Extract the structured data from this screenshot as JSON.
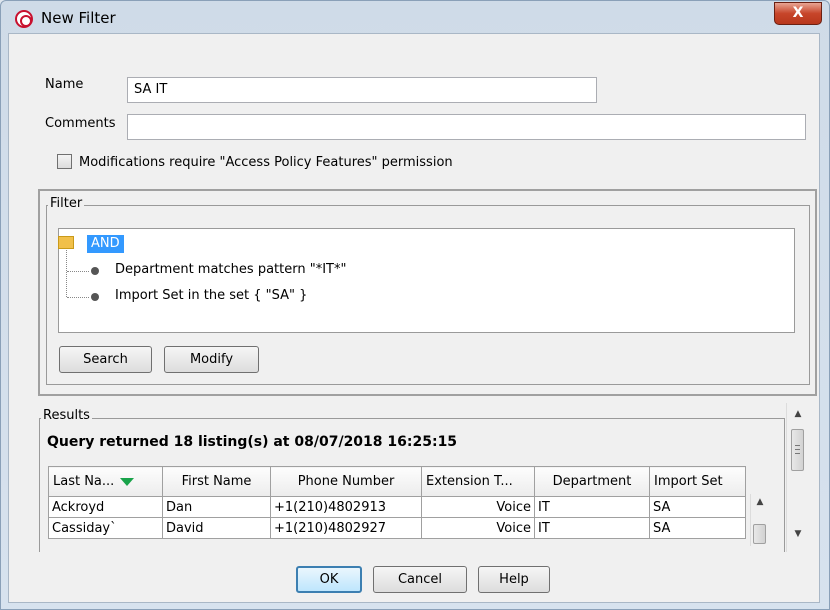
{
  "window": {
    "title": "New Filter",
    "close_glyph": "X"
  },
  "form": {
    "name_label": "Name",
    "name_value": "SA IT",
    "comments_label": "Comments",
    "comments_value": "",
    "checkbox_label": "Modifications require \"Access Policy Features\" permission",
    "checkbox_checked": false
  },
  "filter": {
    "group_title": "Filter",
    "root": "AND",
    "conditions": [
      "Department matches pattern \"*IT*\"",
      "Import Set in the set { \"SA\" }"
    ],
    "search_button": "Search",
    "modify_button": "Modify"
  },
  "results": {
    "group_title": "Results",
    "summary": "Query returned 18 listing(s) at 08/07/2018 16:25:15",
    "columns": [
      "Last Na...",
      "First Name",
      "Phone Number",
      "Extension T...",
      "Department",
      "Import Set"
    ],
    "rows": [
      [
        "Ackroyd",
        "Dan",
        "+1(210)4802913",
        "Voice",
        "IT",
        "SA"
      ],
      [
        "Cassiday`",
        "David",
        "+1(210)4802927",
        "Voice",
        "IT",
        "SA"
      ]
    ]
  },
  "buttons": {
    "ok": "OK",
    "cancel": "Cancel",
    "help": "Help"
  },
  "colors": {
    "selection": "#3399ff",
    "sort_indicator": "#19a34a",
    "close_button": "#c7452a"
  }
}
